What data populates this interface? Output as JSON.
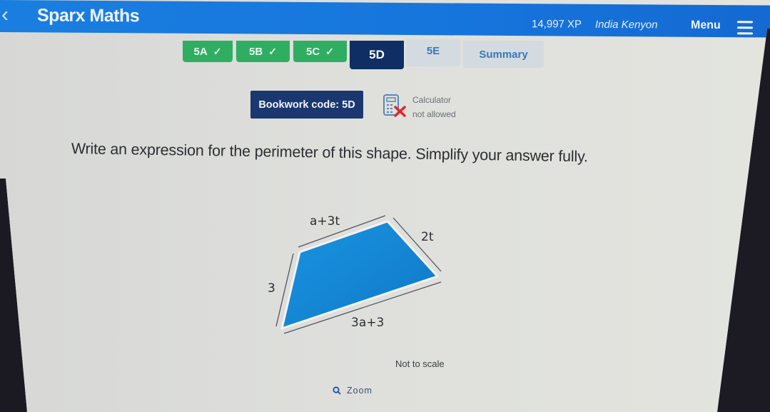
{
  "header": {
    "app_title": "Sparx Maths",
    "xp": "14,997 XP",
    "user_name": "India Kenyon",
    "menu_label": "Menu"
  },
  "tabs": [
    {
      "label": "5A",
      "status": "done"
    },
    {
      "label": "5B",
      "status": "done"
    },
    {
      "label": "5C",
      "status": "done"
    },
    {
      "label": "5D",
      "status": "active"
    },
    {
      "label": "5E",
      "status": "todo"
    },
    {
      "label": "Summary",
      "status": "todo"
    }
  ],
  "bookwork": {
    "label": "Bookwork code: 5D"
  },
  "calculator": {
    "line1": "Calculator",
    "line2": "not allowed"
  },
  "question": {
    "text": "Write an expression for the perimeter of this shape. Simplify your answer fully."
  },
  "diagram": {
    "sides": {
      "top": "a+3t",
      "right": "2t",
      "left": "3",
      "bottom": "3a+3"
    },
    "fill_color": "#1487d6",
    "note": "Not to scale"
  },
  "zoom": {
    "label": "Zoom"
  },
  "colors": {
    "header_blue": "#1a7ee0",
    "done_green": "#2fae62",
    "active_navy": "#0f2e63"
  }
}
